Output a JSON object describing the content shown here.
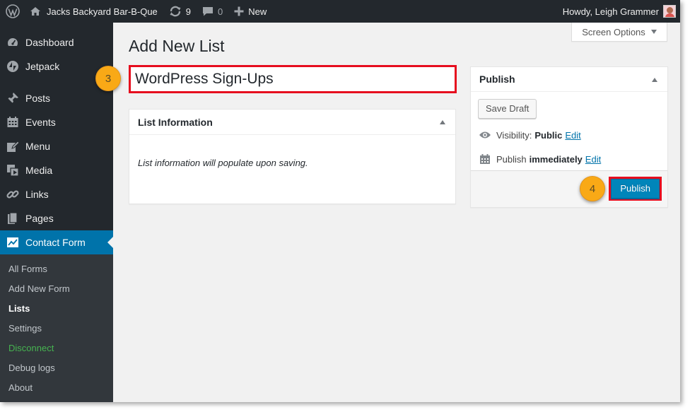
{
  "adminbar": {
    "site_name": "Jacks Backyard Bar-B-Que",
    "updates_count": "9",
    "comments_count": "0",
    "new_label": "New",
    "greeting": "Howdy, Leigh Grammer"
  },
  "sidebar": {
    "menu": [
      {
        "label": "Dashboard",
        "icon": "dashboard-icon"
      },
      {
        "label": "Jetpack",
        "icon": "jetpack-icon"
      },
      {
        "label": "Posts",
        "icon": "pin-icon"
      },
      {
        "label": "Events",
        "icon": "calendar-icon"
      },
      {
        "label": "Menu",
        "icon": "edit-icon"
      },
      {
        "label": "Media",
        "icon": "media-icon"
      },
      {
        "label": "Links",
        "icon": "link-icon"
      },
      {
        "label": "Pages",
        "icon": "pages-icon"
      },
      {
        "label": "Contact Form",
        "icon": "contact-form-icon"
      }
    ],
    "submenu": [
      "All Forms",
      "Add New Form",
      "Lists",
      "Settings",
      "Disconnect",
      "Debug logs",
      "About"
    ]
  },
  "screen_options": "Screen Options",
  "page_title": "Add New List",
  "title_input_value": "WordPress Sign-Ups",
  "steps": {
    "step3": "3",
    "step4": "4"
  },
  "list_info": {
    "heading": "List Information",
    "body": "List information will populate upon saving."
  },
  "publish_box": {
    "heading": "Publish",
    "save_draft": "Save Draft",
    "visibility_label": "Visibility:",
    "visibility_value": "Public",
    "edit_link": "Edit",
    "publish_label": "Publish",
    "publish_value": "immediately",
    "publish_button": "Publish"
  },
  "colors": {
    "adminbar_bg": "#23282d",
    "accent_blue": "#0073aa",
    "highlight_red": "#e60d1e",
    "step_badge": "#f9a916",
    "green_link": "#46b450"
  }
}
